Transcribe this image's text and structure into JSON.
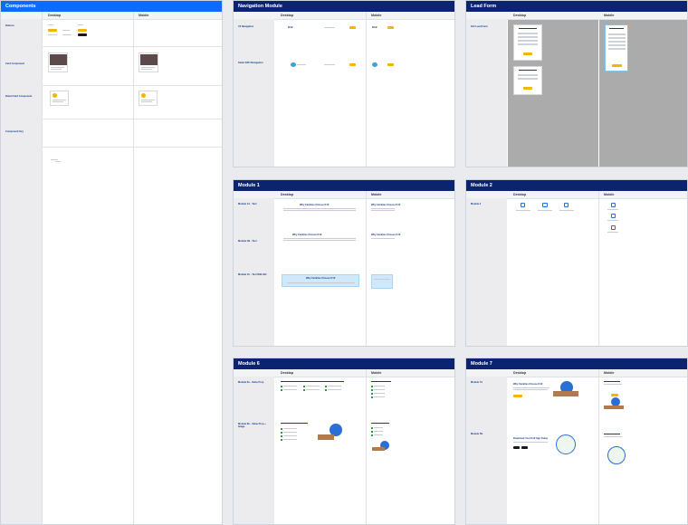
{
  "boards": {
    "components": {
      "title": "Components",
      "col_desktop": "Desktop",
      "col_mobile": "Mobile",
      "rows": [
        {
          "label": "Buttons",
          "sub": "Buttons\nSizes"
        },
        {
          "label": "Card Component",
          "sub": "Buttons\nSizes"
        },
        {
          "label": "Brand Card Component",
          "sub": "Buttons\nSizes"
        },
        {
          "label": "Component Key",
          "sub": "Buttons\nSizes"
        }
      ]
    },
    "navigation": {
      "title": "Navigation Module",
      "col_desktop": "Desktop",
      "col_mobile": "Mobile",
      "rows": [
        {
          "label": "V2 Navigation",
          "sub": "Desktop\nMobile\nCTA"
        },
        {
          "label": "Smart EDU Navigation",
          "sub": "Desktop\nMobile\nCTA"
        }
      ],
      "logo_text": "K12"
    },
    "leadform": {
      "title": "Lead Form",
      "col_desktop": "Desktop",
      "col_mobile": "Mobile",
      "rows": [
        {
          "label": "K12 Lead Form",
          "sub": "Fields\nStates\nSubmit"
        }
      ]
    },
    "module1": {
      "title": "Module 1",
      "col_desktop": "Desktop",
      "col_mobile": "Mobile",
      "rows": [
        {
          "label": "Module 1A - Text",
          "sub": "Headline\nBody"
        },
        {
          "label": "Module 1B - Text",
          "sub": "Headline\nBody"
        },
        {
          "label": "Module 1C - Text With BG",
          "sub": "Headline\nBody"
        }
      ],
      "headline": "Why Families Choose K12"
    },
    "module2": {
      "title": "Module 2",
      "col_desktop": "Desktop",
      "col_mobile": "Mobile",
      "rows": [
        {
          "label": "Module 2",
          "sub": "Icons\nText"
        }
      ]
    },
    "module6": {
      "title": "Module 6",
      "col_desktop": "Desktop",
      "col_mobile": "Mobile",
      "rows": [
        {
          "label": "Module 6a - Value Prop",
          "sub": "Headline\nChecklist"
        },
        {
          "label": "Module 6b - Value Prop + Image",
          "sub": "Headline\nChecklist"
        }
      ]
    },
    "module7": {
      "title": "Module 7",
      "col_desktop": "Desktop",
      "col_mobile": "Mobile",
      "rows": [
        {
          "label": "Module 7A",
          "sub": "Text + Image"
        },
        {
          "label": "Module 7B",
          "sub": "Text + Image"
        }
      ],
      "headline_a": "Why Families Choose K12",
      "headline_b": "Download Your K12 App Today"
    }
  }
}
